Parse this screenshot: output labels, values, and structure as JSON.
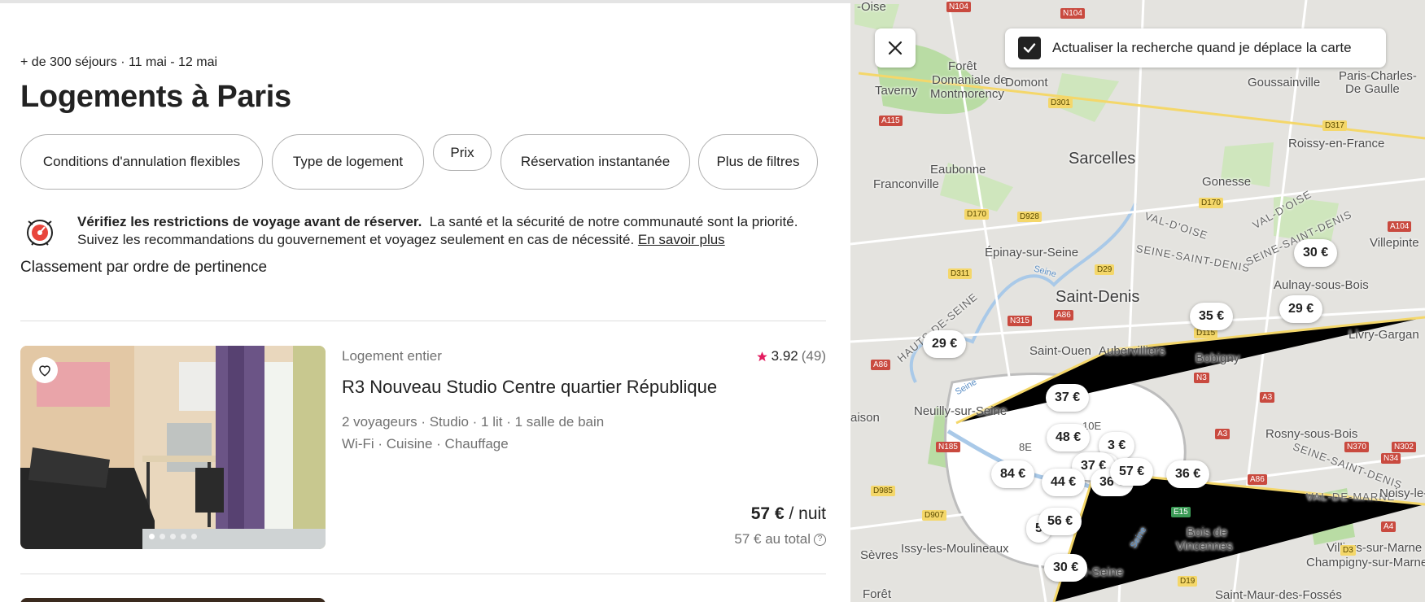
{
  "header": {
    "subtitle": "+ de 300 séjours · 11 mai - 12 mai",
    "title": "Logements à Paris"
  },
  "filters": {
    "cancellation": "Conditions d'annulation flexibles",
    "type": "Type de logement",
    "price": "Prix",
    "instant": "Réservation instantanée",
    "more": "Plus de filtres"
  },
  "notice": {
    "icon": "travel-alert-icon",
    "bold": "Vérifiez les restrictions de voyage avant de réserver.",
    "text": "La santé et la sécurité de notre communauté sont la priorité. Suivez les recommandations du gouvernement et voyagez seulement en cas de nécessité.",
    "link": "En savoir plus"
  },
  "sort_label": "Classement par ordre de pertinence",
  "listing": {
    "type": "Logement entier",
    "rating": "3.92",
    "reviews": "(49)",
    "name": "R3 Nouveau Studio Centre quartier République",
    "specs": "2 voyageurs · Studio · 1 lit · 1 salle de bain",
    "amenities": "Wi-Fi · Cuisine · Chauffage",
    "price": "57 €",
    "price_unit": "/ nuit",
    "total": "57 € au total",
    "photo_count": 5,
    "active_photo": 1
  },
  "map": {
    "toggle_label": "Actualiser la recherche quand je déplace la carte",
    "toggle_checked": true,
    "labels": {
      "oise": "-Oise",
      "foret": "Forêt",
      "domaniale": "Domaniale de",
      "montmorency": "Montmorency",
      "domont": "Domont",
      "taverny": "Taverny",
      "goussainville": "Goussainville",
      "pcdg1": "Paris-Charles-",
      "pcdg2": "De Gaulle",
      "roissy": "Roissy-en-France",
      "sarcelles": "Sarcelles",
      "eaubonne": "Eaubonne",
      "franconville": "Franconville",
      "gonesse": "Gonesse",
      "valdoise1": "VAL-D'OISE",
      "valdoise2": "VAL-D'OISE",
      "ssd1": "SEINE-SAINT-DENIS",
      "ssd2": "SEINE-SAINT-DENIS",
      "villepinte": "Villepinte",
      "epinay": "Épinay-sur-Seine",
      "saintdenis": "Saint-Denis",
      "aulnay": "Aulnay-sous-Bois",
      "hautsdeseine": "HAUTS-DE-SEINE",
      "saintouen": "Saint-Ouen",
      "aubervilliers": "Aubervilliers",
      "livry": "Livry-Gargan",
      "bobigny": "Bobigny",
      "neuilly": "Neuilly-sur-Seine",
      "maison": "aison",
      "rosny": "Rosny-sous-Bois",
      "ssd3": "SEINE-SAINT-DENIS",
      "valdemarne": "VAL-DE-MARNE",
      "noisy": "Noisy-le-Gran",
      "bois1": "Bois de",
      "bois2": "Vincennes",
      "issy": "Issy-les-Moulineaux",
      "sevres": "Sèvres",
      "ivry": "Ivry-sur-Seine",
      "villiers": "Villiers-sur-Marne",
      "champigny": "Champigny-sur-Marne",
      "foret2": "Forêt",
      "saintmaur": "Saint-Maur-des-Fossés",
      "seine1": "Seine",
      "seine2": "Seine",
      "seine3": "Seine",
      "arr8": "8E",
      "arr10": "10E",
      "r_n104a": "N104",
      "r_n104b": "N104",
      "r_a115": "A115",
      "r_d301": "D301",
      "r_d317": "D317",
      "r_d170a": "D170",
      "r_d170b": "D170",
      "r_d928": "D928",
      "r_a104": "A104",
      "r_d311": "D311",
      "r_d29": "D29",
      "r_n315": "N315",
      "r_a86a": "A86",
      "r_a86b": "A86",
      "r_d115": "D115",
      "r_n3": "N3",
      "r_a3a": "A3",
      "r_a3b": "A3",
      "r_n185": "N185",
      "r_n370": "N370",
      "r_n302": "N302",
      "r_a86c": "A86",
      "r_n34": "N34",
      "r_d985": "D985",
      "r_d907": "D907",
      "r_e15": "E15",
      "r_a4": "A4",
      "r_d3": "D3",
      "r_d19": "D19"
    },
    "pins": [
      "30 €",
      "35 €",
      "29 €",
      "29 €",
      "37 €",
      "48 €",
      "3 €",
      "37 €",
      "84 €",
      "44 €",
      "36 €",
      "57 €",
      "36 €",
      "56 €",
      "5",
      "30 €",
      "37 €"
    ]
  }
}
